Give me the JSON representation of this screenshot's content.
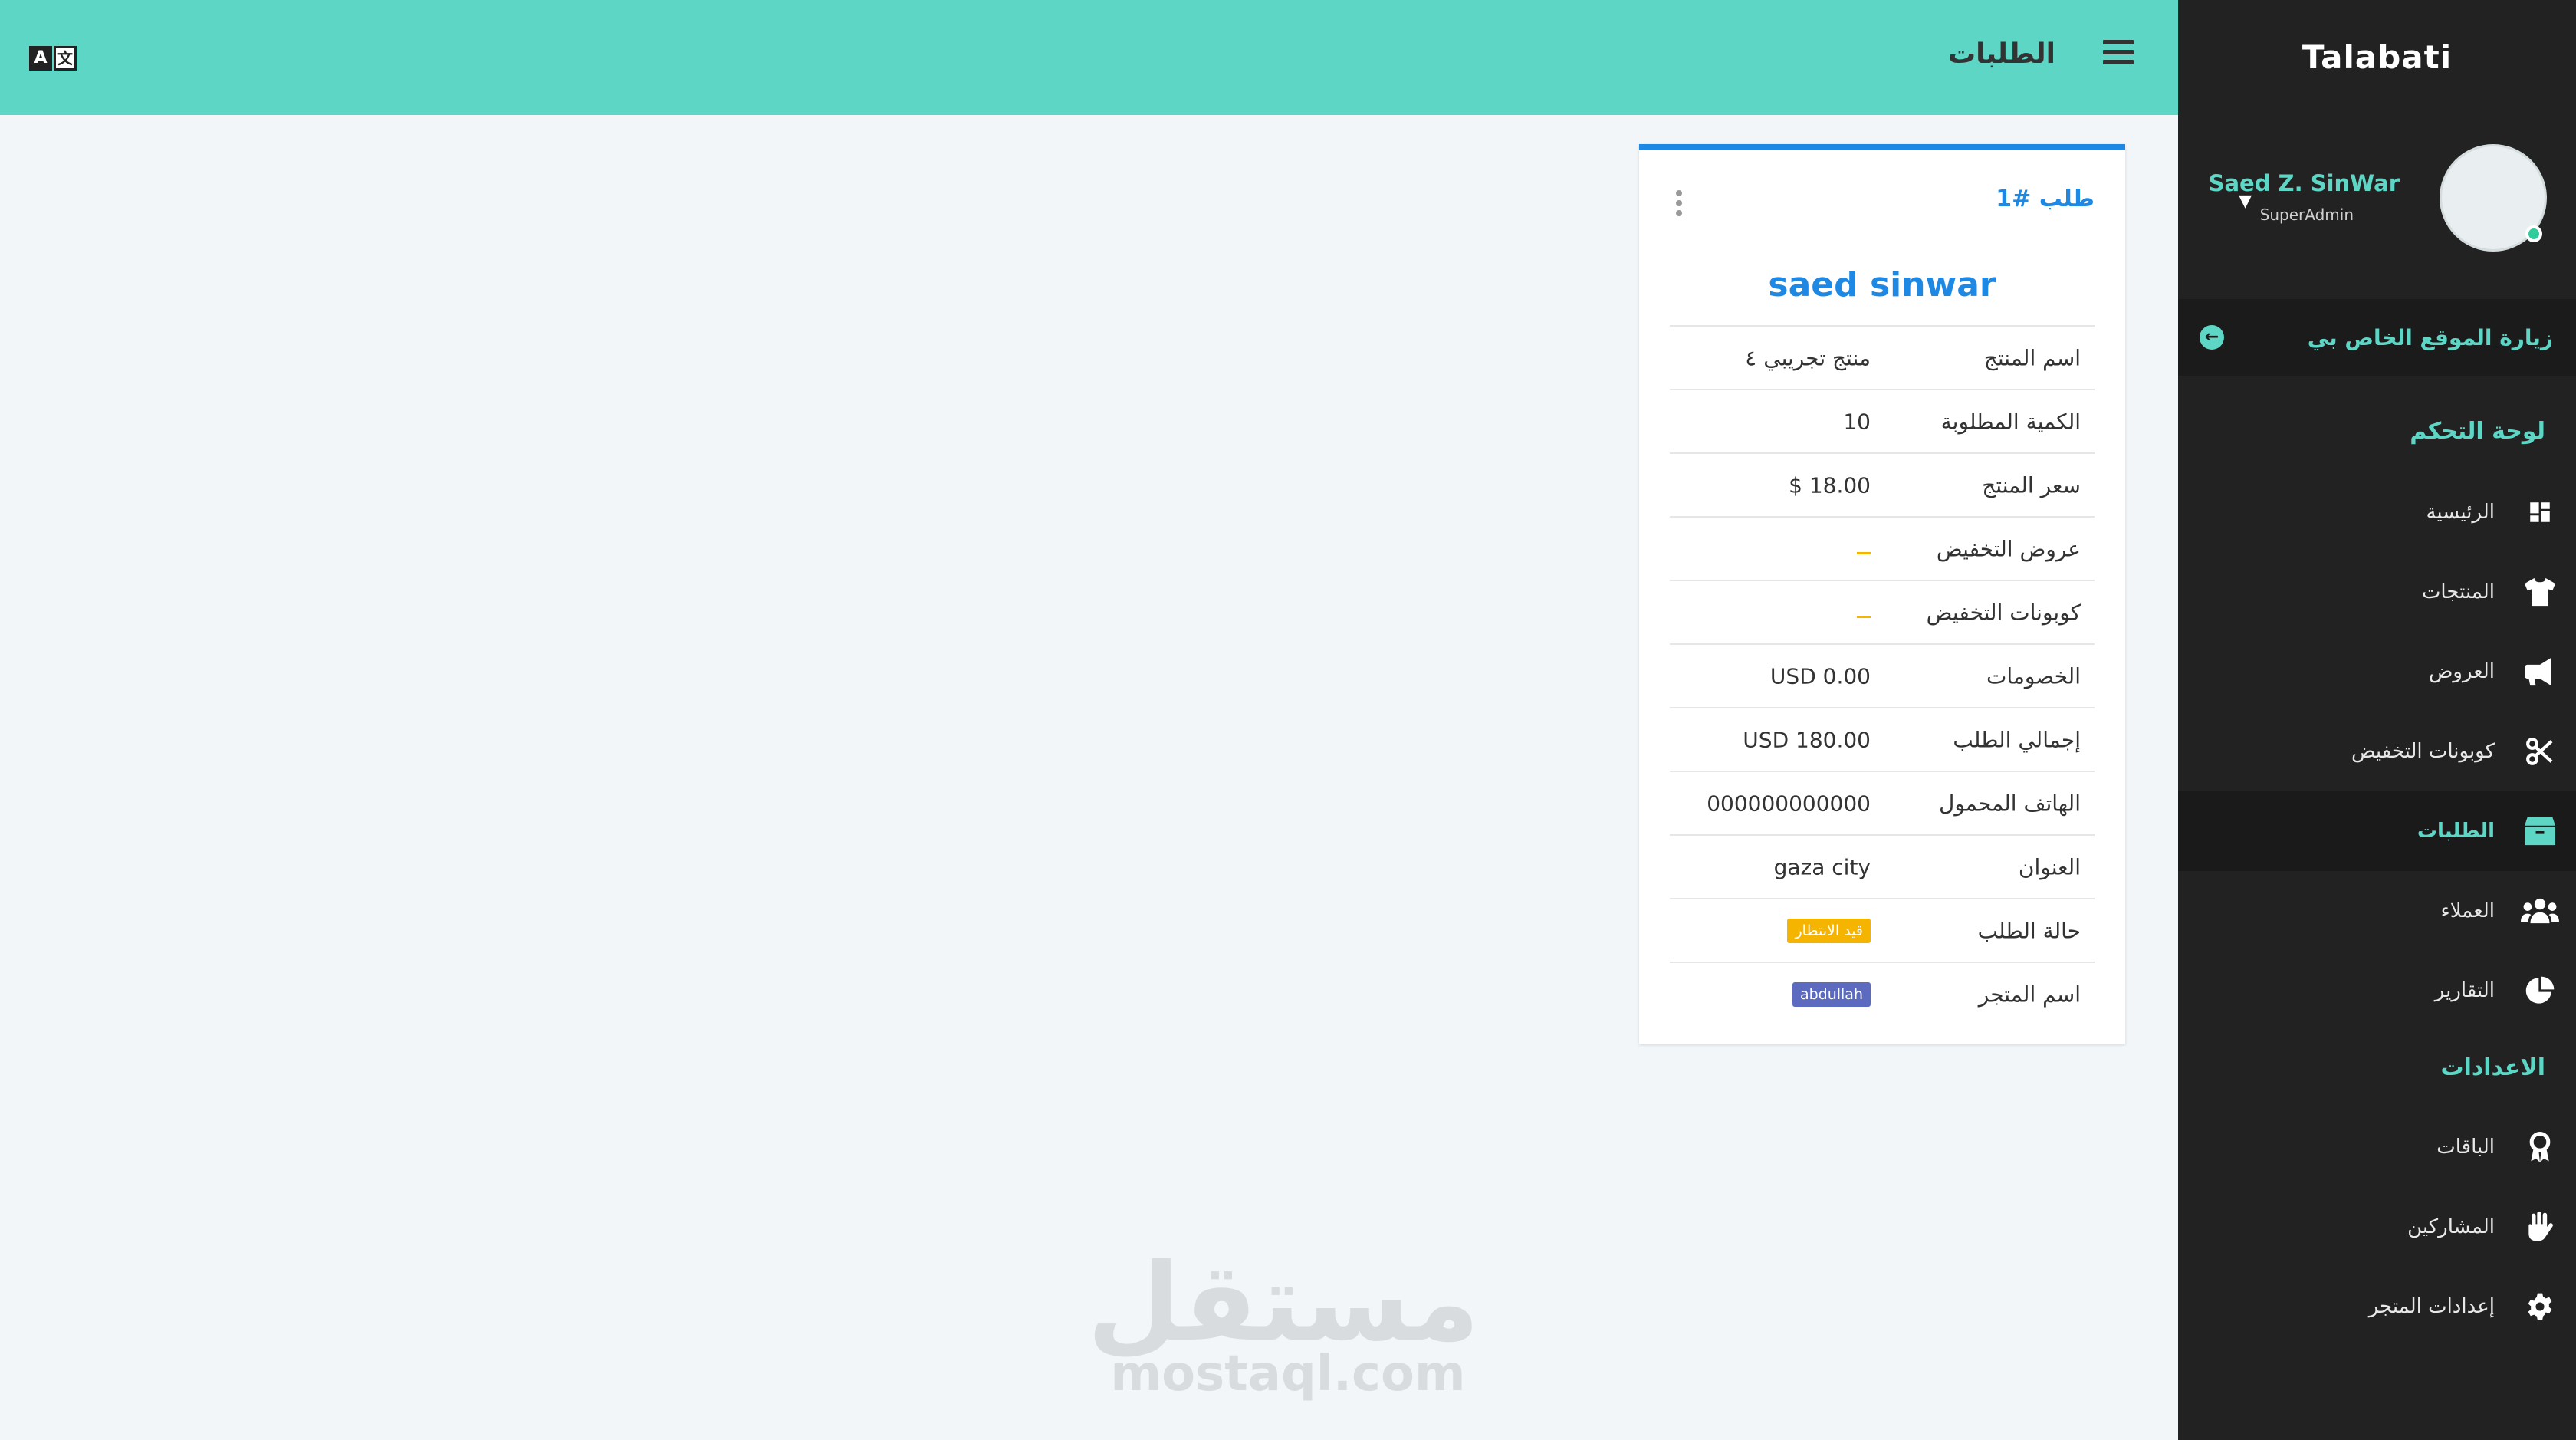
{
  "app": {
    "brand": "Talabati"
  },
  "colors": {
    "accent": "#5ed6c6",
    "sidebar_bg": "#222222",
    "primary": "#1e88e5",
    "warning": "#f5b400",
    "info": "#5c6bc0"
  },
  "user": {
    "name": "Saed Z. SinWar",
    "role": "SuperAdmin",
    "status": "online"
  },
  "sidebar": {
    "visit_site": "زيارة الموقع الخاص بي",
    "sections": [
      {
        "title": "لوحة التحكم",
        "items": [
          {
            "label": "الرئيسية",
            "icon": "dashboard-icon"
          },
          {
            "label": "المنتجات",
            "icon": "tshirt-icon"
          },
          {
            "label": "العروض",
            "icon": "megaphone-icon"
          },
          {
            "label": "كوبونات التخفيض",
            "icon": "scissors-icon"
          },
          {
            "label": "الطلبات",
            "icon": "box-icon",
            "active": true
          },
          {
            "label": "العملاء",
            "icon": "users-icon"
          },
          {
            "label": "التقارير",
            "icon": "pie-chart-icon"
          }
        ]
      },
      {
        "title": "الاعدادات",
        "items": [
          {
            "label": "الباقات",
            "icon": "award-icon"
          },
          {
            "label": "المشاركين",
            "icon": "hand-icon"
          },
          {
            "label": "إعدادات المتجر",
            "icon": "gear-icon"
          }
        ]
      }
    ]
  },
  "header": {
    "title": "الطلبات",
    "lang_a": "A",
    "lang_b": "文"
  },
  "order": {
    "title": "طلب #1",
    "customer": "saed sinwar",
    "rows": [
      {
        "label": "اسم المنتج",
        "value": "منتج تجريبي ٤"
      },
      {
        "label": "الكمية المطلوبة",
        "value": "10"
      },
      {
        "label": "سعر المنتج",
        "value": "$ 18.00"
      },
      {
        "label": "عروض التخفيض",
        "value": "-"
      },
      {
        "label": "كوبونات التخفيض",
        "value": "-"
      },
      {
        "label": "الخصومات",
        "value": "USD 0.00"
      },
      {
        "label": "إجمالي الطلب",
        "value": "USD 180.00"
      },
      {
        "label": "الهاتف المحمول",
        "value": "000000000000"
      },
      {
        "label": "العنوان",
        "value": "gaza city"
      },
      {
        "label": "حالة الطلب",
        "value": "قيد الانتظار"
      },
      {
        "label": "اسم المتجر",
        "value": "abdullah"
      }
    ]
  },
  "watermark": {
    "arabic": "مستقل",
    "latin": "mostaql.com"
  }
}
